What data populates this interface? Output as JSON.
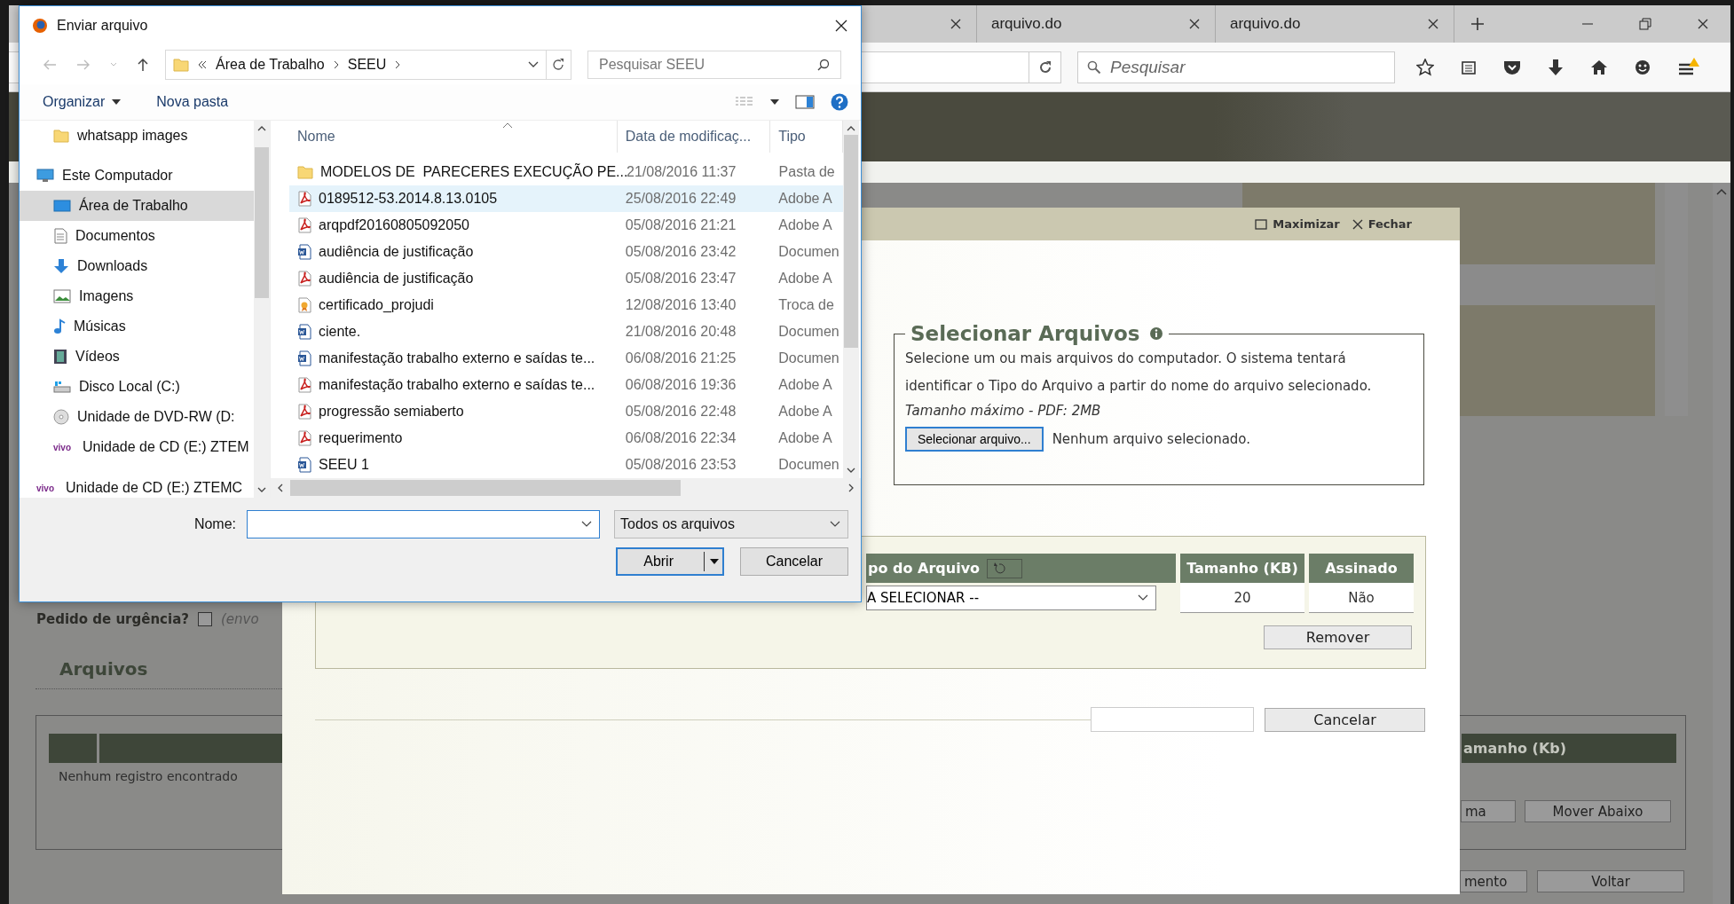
{
  "browser": {
    "tabs": [
      {
        "label": "arquivo.do",
        "selected": false
      },
      {
        "label": "arquivo.do",
        "selected": false
      }
    ],
    "search_placeholder": "Pesquisar"
  },
  "page": {
    "urgency": {
      "label": "Pedido de urgência?",
      "checked": false,
      "note": "(envo"
    },
    "section_title": "Arquivos",
    "files_table": {
      "columns": [
        "amanho (Kb)"
      ],
      "empty_message": "Nenhum registro encontrado"
    },
    "row_buttons": [
      "ma",
      "Mover Abaixo"
    ],
    "footer_buttons": [
      "mento",
      "Voltar"
    ]
  },
  "modal": {
    "window_actions": [
      {
        "kind": "maximize",
        "label": "Maximizar"
      },
      {
        "kind": "close",
        "label": "Fechar"
      }
    ],
    "file_picker": {
      "legend": "Selecionar Arquivos",
      "description": "Selecione um ou mais arquivos do computador. O sistema tentará identificar o Tipo do Arquivo a partir do nome do arquivo selecionado.",
      "limit": "Tamanho máximo - PDF: 2MB",
      "button": "Selecionar arquivo...",
      "status": "Nenhum arquivo selecionado."
    },
    "files_table": {
      "columns": [
        "po do Arquivo",
        "Tamanho (KB)",
        "Assinado"
      ],
      "rows": [
        {
          "type": "A SELECIONAR --",
          "size": "20",
          "signed": "Não"
        }
      ]
    },
    "remove_button": "Remover",
    "cancel_button": "Cancelar"
  },
  "file_dialog": {
    "title": "Enviar arquivo",
    "path": [
      "Área de Trabalho",
      "SEEU"
    ],
    "search_placeholder": "Pesquisar SEEU",
    "commands": [
      "Organizar",
      "Nova pasta"
    ],
    "nav": {
      "partial_children": [
        {
          "label": "whatsapp images",
          "kind": "folder",
          "selected": false
        }
      ],
      "items": [
        {
          "label": "Este Computador",
          "kind": "computer",
          "selected": false,
          "children": [
            {
              "label": "Área de Trabalho",
              "kind": "desktop",
              "selected": true
            },
            {
              "label": "Documentos",
              "kind": "documents",
              "selected": false
            },
            {
              "label": "Downloads",
              "kind": "downloads",
              "selected": false
            },
            {
              "label": "Imagens",
              "kind": "pictures",
              "selected": false
            },
            {
              "label": "Músicas",
              "kind": "music",
              "selected": false
            },
            {
              "label": "Vídeos",
              "kind": "videos",
              "selected": false
            },
            {
              "label": "Disco Local (C:)",
              "kind": "disk",
              "selected": false
            },
            {
              "label": "Unidade de DVD-RW (D:",
              "kind": "dvd",
              "selected": false
            },
            {
              "label": "Unidade de CD (E:) ZTEM",
              "kind": "cd",
              "badge": "vivo",
              "selected": false
            }
          ]
        },
        {
          "label": "Unidade de CD (E:) ZTEMC",
          "kind": "cd",
          "badge": "vivo",
          "selected": false
        }
      ]
    },
    "columns": [
      "Nome",
      "Data de modificaç...",
      "Tipo"
    ],
    "files": [
      {
        "name": "MODELOS DE  PARECERES EXECUÇÃO PE...",
        "date": "21/08/2016 11:37",
        "type": "Pasta de",
        "kind": "folder",
        "selected": false
      },
      {
        "name": "0189512-53.2014.8.13.0105",
        "date": "25/08/2016 22:49",
        "type": "Adobe A",
        "kind": "pdf",
        "selected": true
      },
      {
        "name": "arqpdf20160805092050",
        "date": "05/08/2016 21:21",
        "type": "Adobe A",
        "kind": "pdf",
        "selected": false
      },
      {
        "name": "audiência de justificação",
        "date": "05/08/2016 23:42",
        "type": "Documen",
        "kind": "word",
        "selected": false
      },
      {
        "name": "audiência de justificação",
        "date": "05/08/2016 23:47",
        "type": "Adobe A",
        "kind": "pdf",
        "selected": false
      },
      {
        "name": "certificado_projudi",
        "date": "12/08/2016 13:40",
        "type": "Troca de",
        "kind": "cert",
        "selected": false
      },
      {
        "name": "ciente.",
        "date": "21/08/2016 20:48",
        "type": "Documen",
        "kind": "word",
        "selected": false
      },
      {
        "name": "manifestação trabalho externo e saídas te...",
        "date": "06/08/2016 21:25",
        "type": "Documen",
        "kind": "word",
        "selected": false
      },
      {
        "name": "manifestação trabalho externo e saídas te...",
        "date": "06/08/2016 19:36",
        "type": "Adobe A",
        "kind": "pdf",
        "selected": false
      },
      {
        "name": "progressão semiaberto",
        "date": "05/08/2016 22:48",
        "type": "Adobe A",
        "kind": "pdf",
        "selected": false
      },
      {
        "name": "requerimento",
        "date": "06/08/2016 22:34",
        "type": "Adobe A",
        "kind": "pdf",
        "selected": false
      },
      {
        "name": "SEEU 1",
        "date": "05/08/2016 23:53",
        "type": "Documen",
        "kind": "word",
        "selected": false
      }
    ],
    "name_label": "Nome:",
    "name_field": {
      "focused": true
    },
    "filter": "Todos os arquivos",
    "buttons": [
      "Abrir",
      "Cancelar"
    ]
  }
}
